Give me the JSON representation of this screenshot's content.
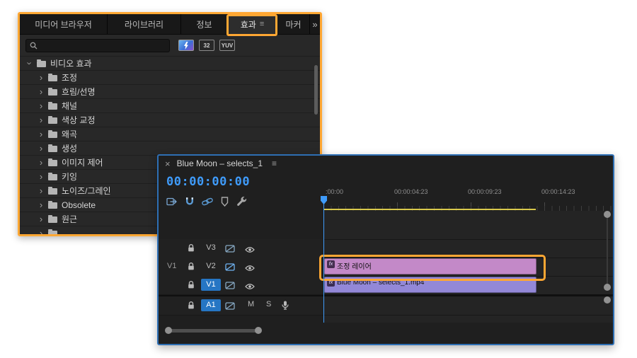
{
  "colors": {
    "annotation_orange": "#ffa733",
    "timeline_border_blue": "#2e6fb4",
    "timecode_blue": "#3f9bfa",
    "adjustment_clip_pink": "#c389c8",
    "video_clip_purple": "#9388d8",
    "track_target_blue": "#2676c4",
    "work_area_yellow": "#d9c94b"
  },
  "icons": {
    "chevron": "›",
    "overflow_chevron": "»",
    "panel_menu": "≡",
    "close": "×"
  },
  "effects_panel": {
    "tabs": [
      {
        "label": "미디어 브라우저"
      },
      {
        "label": "라이브러리"
      },
      {
        "label": "정보"
      },
      {
        "label": "효과",
        "active": true
      },
      {
        "label": "마커"
      }
    ],
    "filters": {
      "bit32": "32",
      "yuv": "YUV"
    },
    "tree": [
      {
        "label": "비디오 효과",
        "expanded": true
      },
      {
        "label": "조정"
      },
      {
        "label": "흐림/선명"
      },
      {
        "label": "채널"
      },
      {
        "label": "색상 교정"
      },
      {
        "label": "왜곡"
      },
      {
        "label": "생성"
      },
      {
        "label": "이미지 제어"
      },
      {
        "label": "키잉"
      },
      {
        "label": "노이즈/그레인"
      },
      {
        "label": "Obsolete"
      },
      {
        "label": "원근"
      }
    ]
  },
  "timeline_panel": {
    "title": "Blue Moon – selects_1",
    "timecode": "00:00:00:00",
    "ruler_labels": [
      ":00:00",
      "00:00:04:23",
      "00:00:09:23",
      "00:00:14:23"
    ],
    "tracks": [
      {
        "name": "V3"
      },
      {
        "name": "V2",
        "source_patch": "V1"
      },
      {
        "name": "V1",
        "targeted": true
      },
      {
        "name": "A1",
        "targeted": true
      }
    ],
    "audio_buttons": {
      "mute": "M",
      "solo": "S"
    },
    "clips": [
      {
        "label": "조정 레이어",
        "badge": "fx"
      },
      {
        "label": "Blue Moon – selects_1.mp4",
        "badge": "fx"
      }
    ]
  }
}
